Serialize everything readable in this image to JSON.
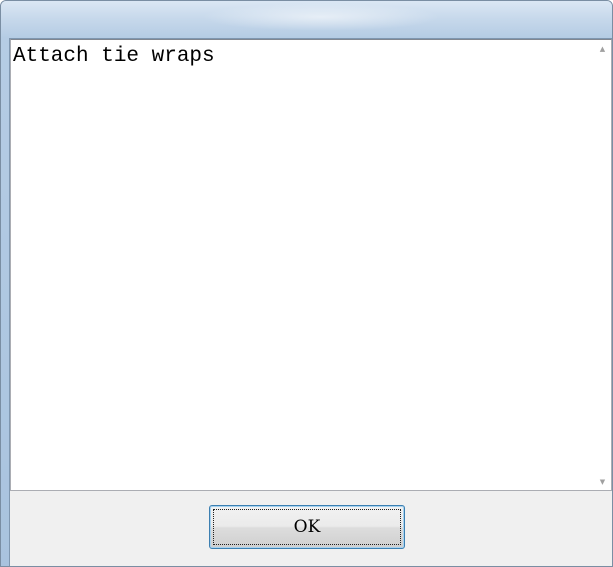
{
  "dialog": {
    "message": "Attach tie wraps",
    "ok_label": "OK",
    "scroll_up_icon": "scroll-up-arrow",
    "scroll_down_icon": "scroll-down-arrow",
    "colors": {
      "frame": "#b9cfe6",
      "button_border": "#3c7fb1",
      "client_background": "#f0f0f0"
    }
  }
}
